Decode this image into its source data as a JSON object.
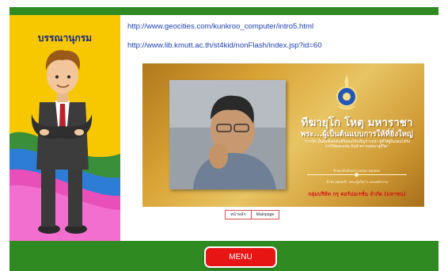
{
  "sidebar": {
    "title": "บรรณานุกรม"
  },
  "links": [
    {
      "url": "http://www.geocities.com/kunkroo_computer/intro5.html"
    },
    {
      "url": "http://www.lib.kmutt.ac.th/st4kid/nonFlash/index.jsp?id=60"
    }
  ],
  "banner": {
    "title": "ทีฆายุโก โหตุ มหาราชา",
    "subtitle": "พระ...ผู้เป็นต้นแบบการให้ที่ยิ่งใหญ่",
    "quote": "\"การให้ เป็นสิ่งที่ผลักดันชีวิตคนให้เจริญก้าวหน้า ผู้ที่ให้ผู้อื่นย่อมได้รับการให้ตอบแทน อันนำความสุขมาสู่ชีวิต\"",
    "small_line_1": "ด้วยเกล้าด้วยกระหม่อม ขอเดชะ",
    "small_line_2": "ข้าพระพุทธเจ้า คณะผู้บริหาร และพนักงาน",
    "group": "กลุ่มบริษัท กรุ คอร์ปอเรชั่น จำกัด (มหาชน)"
  },
  "nav": {
    "home": "หน้าหลัก",
    "mainpage": "Mainpage"
  },
  "menu_button": "MENU",
  "colors": {
    "bar_green": "#2f8a22",
    "menu_red": "#e81515",
    "link_blue": "#1c3fb3"
  }
}
